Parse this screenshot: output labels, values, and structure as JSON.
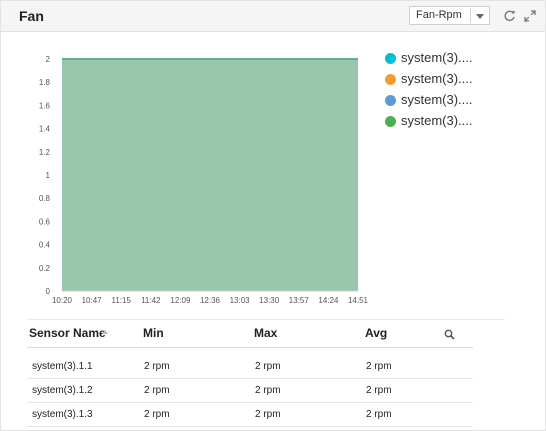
{
  "panel": {
    "title": "Fan",
    "metric_select": {
      "selected": "Fan-Rpm"
    },
    "icons": [
      "refresh-icon",
      "expand-icon"
    ]
  },
  "chart_data": {
    "type": "area",
    "x": [
      "10:20",
      "10:47",
      "11:15",
      "11:42",
      "12:09",
      "12:36",
      "13:03",
      "13:30",
      "13:57",
      "14:24",
      "14:51"
    ],
    "series": [
      {
        "name": "system(3)....",
        "color": "#00bcd4",
        "values": [
          2,
          2,
          2,
          2,
          2,
          2,
          2,
          2,
          2,
          2,
          2
        ]
      },
      {
        "name": "system(3)....",
        "color": "#f39c36",
        "values": [
          2,
          2,
          2,
          2,
          2,
          2,
          2,
          2,
          2,
          2,
          2
        ]
      },
      {
        "name": "system(3)....",
        "color": "#5a9bd6",
        "values": [
          2,
          2,
          2,
          2,
          2,
          2,
          2,
          2,
          2,
          2,
          2
        ]
      },
      {
        "name": "system(3)....",
        "color": "#4caf50",
        "values": [
          2,
          2,
          2,
          2,
          2,
          2,
          2,
          2,
          2,
          2,
          2
        ]
      }
    ],
    "yticks": [
      "2",
      "1.8",
      "1.6",
      "1.4",
      "1.2",
      "1",
      "0.8",
      "0.6",
      "0.4",
      "0.2",
      "0"
    ],
    "ylim": [
      0,
      2
    ],
    "grid": true,
    "legend": "right",
    "area_fill": "#99c7ad",
    "line_color": "#5fae82"
  },
  "table": {
    "headers": {
      "sensor_name": "Sensor Name",
      "min": "Min",
      "max": "Max",
      "avg": "Avg"
    },
    "rows": [
      {
        "name": "system(3).1.1",
        "min": "2 rpm",
        "max": "2 rpm",
        "avg": "2 rpm"
      },
      {
        "name": "system(3).1.2",
        "min": "2 rpm",
        "max": "2 rpm",
        "avg": "2 rpm"
      },
      {
        "name": "system(3).1.3",
        "min": "2 rpm",
        "max": "2 rpm",
        "avg": "2 rpm"
      }
    ]
  }
}
